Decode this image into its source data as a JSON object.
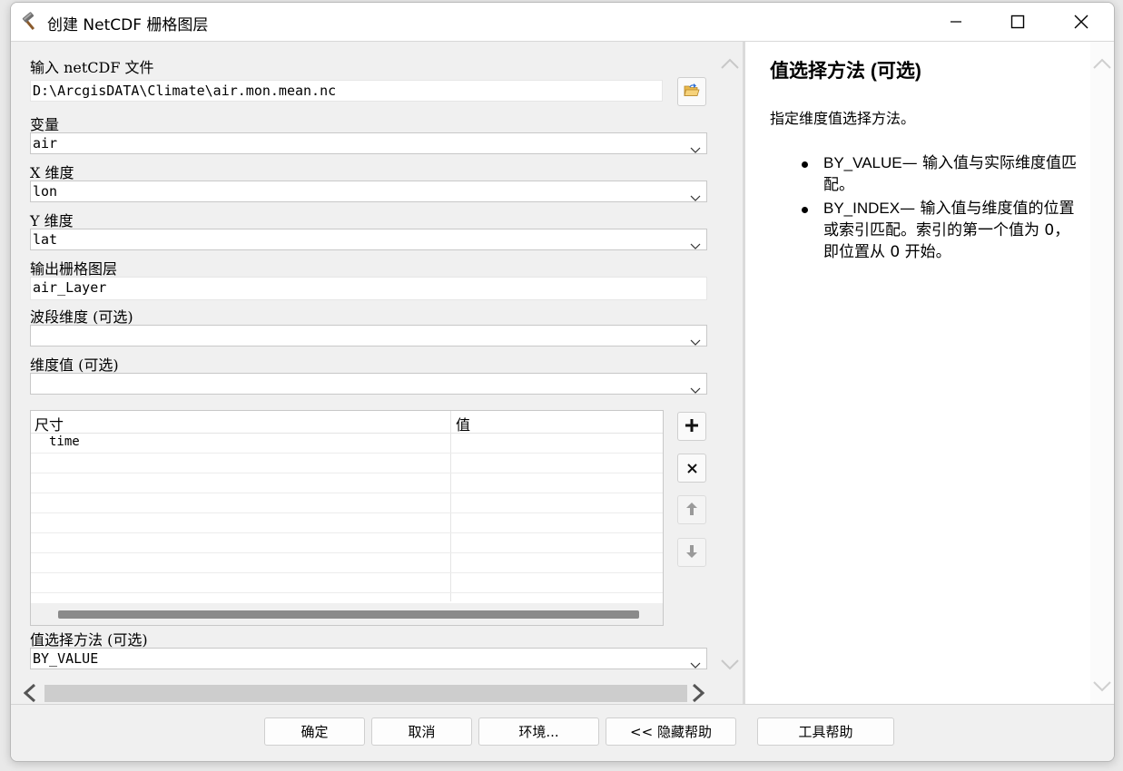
{
  "window": {
    "title": "创建 NetCDF 栅格图层",
    "icon": "hammer-icon"
  },
  "form": {
    "input_label": "输入 netCDF 文件",
    "input_value": "D:\\ArcgisDATA\\Climate\\air.mon.mean.nc",
    "variable_label": "变量",
    "variable_value": "air",
    "x_label": "X 维度",
    "x_value": "lon",
    "y_label": "Y 维度",
    "y_value": "lat",
    "output_label": "输出栅格图层",
    "output_value": "air_Layer",
    "band_label": "波段维度 (可选)",
    "band_value": "",
    "dimval_label": "维度值 (可选)",
    "dimval_value": "",
    "grid": {
      "headers": [
        "尺寸",
        "值"
      ],
      "rows": [
        [
          "time",
          ""
        ]
      ]
    },
    "method_label": "值选择方法 (可选)",
    "method_value": "BY_VALUE"
  },
  "help": {
    "title": "值选择方法 (可选)",
    "description": "指定维度值选择方法。",
    "items": [
      {
        "keyword": "BY_VALUE",
        "text": "— 输入值与实际维度值匹配。"
      },
      {
        "keyword": "BY_INDEX",
        "text": "— 输入值与维度值的位置或索引匹配。索引的第一个值为 0，即位置从 0 开始。"
      }
    ]
  },
  "footer": {
    "ok": "确定",
    "cancel": "取消",
    "env": "环境...",
    "hide_help": "<< 隐藏帮助",
    "tool_help": "工具帮助"
  }
}
